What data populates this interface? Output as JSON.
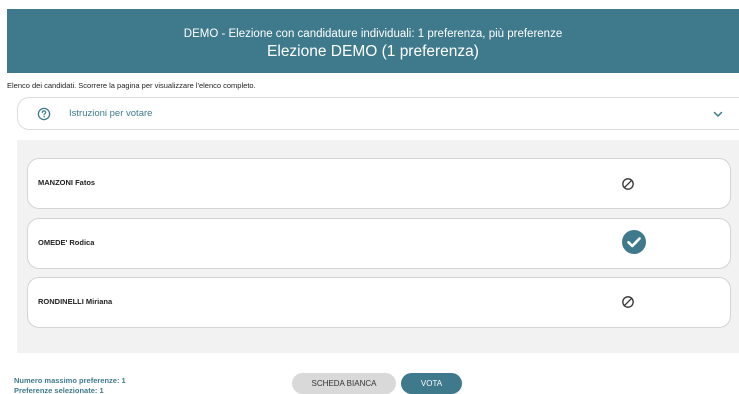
{
  "header": {
    "subtitle": "DEMO - Elezione con candidature individuali: 1 preferenza, più preferenze",
    "title": "Elezione DEMO (1 preferenza)",
    "background": "#3f7a8c"
  },
  "intro_text": "Elenco dei candidati. Scorrere la pagina per visualizzare l'elenco completo.",
  "instructions": {
    "label": "Istruzioni per votare",
    "icon": "question-circle-icon",
    "toggle_icon": "chevron-down-icon"
  },
  "candidates": [
    {
      "name": "MANZONI Fatos",
      "selected": false,
      "status_icon": "not-selected-icon"
    },
    {
      "name": "OMEDE' Rodica",
      "selected": true,
      "status_icon": "check-circle-icon"
    },
    {
      "name": "RONDINELLI Miriana",
      "selected": false,
      "status_icon": "not-selected-icon"
    }
  ],
  "footer": {
    "max_preferences": "Numero massimo preferenze: 1",
    "selected_preferences": "Preferenze selezionate: 1"
  },
  "buttons": {
    "blank": "SCHEDA BIANCA",
    "vote": "VOTA"
  },
  "colors": {
    "accent": "#3f7a8c",
    "panel": "#f2f2f2",
    "blank_button": "#d9d9d9"
  }
}
